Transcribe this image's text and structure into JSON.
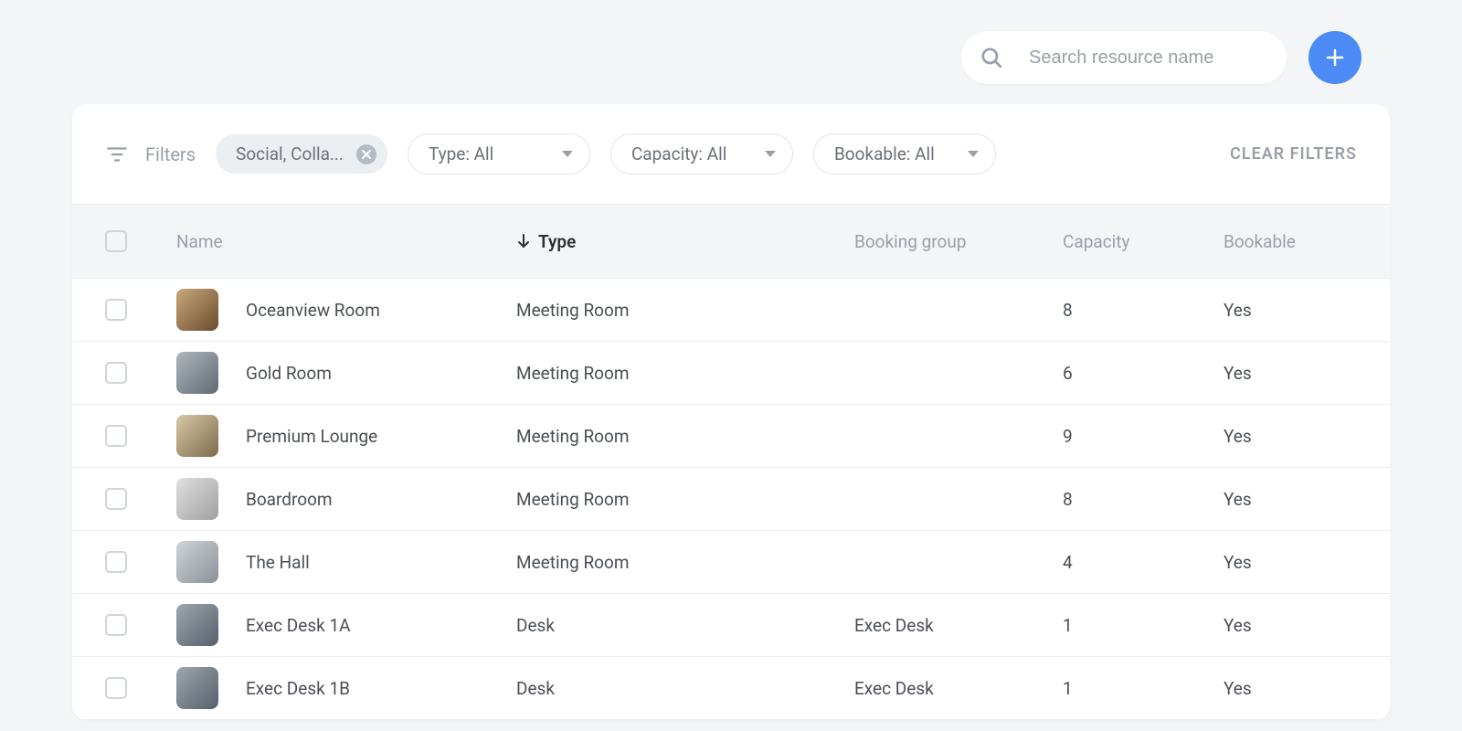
{
  "search": {
    "placeholder": "Search resource name"
  },
  "filters": {
    "label": "Filters",
    "chip": "Social, Colla...",
    "type": "Type: All",
    "capacity": "Capacity: All",
    "bookable": "Bookable: All",
    "clear": "CLEAR FILTERS"
  },
  "columns": {
    "name": "Name",
    "type": "Type",
    "booking_group": "Booking group",
    "capacity": "Capacity",
    "bookable": "Bookable"
  },
  "rows": [
    {
      "name": "Oceanview Room",
      "type": "Meeting Room",
      "booking_group": "",
      "capacity": "8",
      "bookable": "Yes"
    },
    {
      "name": "Gold Room",
      "type": "Meeting Room",
      "booking_group": "",
      "capacity": "6",
      "bookable": "Yes"
    },
    {
      "name": "Premium Lounge",
      "type": "Meeting Room",
      "booking_group": "",
      "capacity": "9",
      "bookable": "Yes"
    },
    {
      "name": "Boardroom",
      "type": "Meeting Room",
      "booking_group": "",
      "capacity": "8",
      "bookable": "Yes"
    },
    {
      "name": "The Hall",
      "type": "Meeting Room",
      "booking_group": "",
      "capacity": "4",
      "bookable": "Yes"
    },
    {
      "name": "Exec Desk 1A",
      "type": "Desk",
      "booking_group": "Exec Desk",
      "capacity": "1",
      "bookable": "Yes"
    },
    {
      "name": "Exec Desk 1B",
      "type": "Desk",
      "booking_group": "Exec Desk",
      "capacity": "1",
      "bookable": "Yes"
    }
  ]
}
